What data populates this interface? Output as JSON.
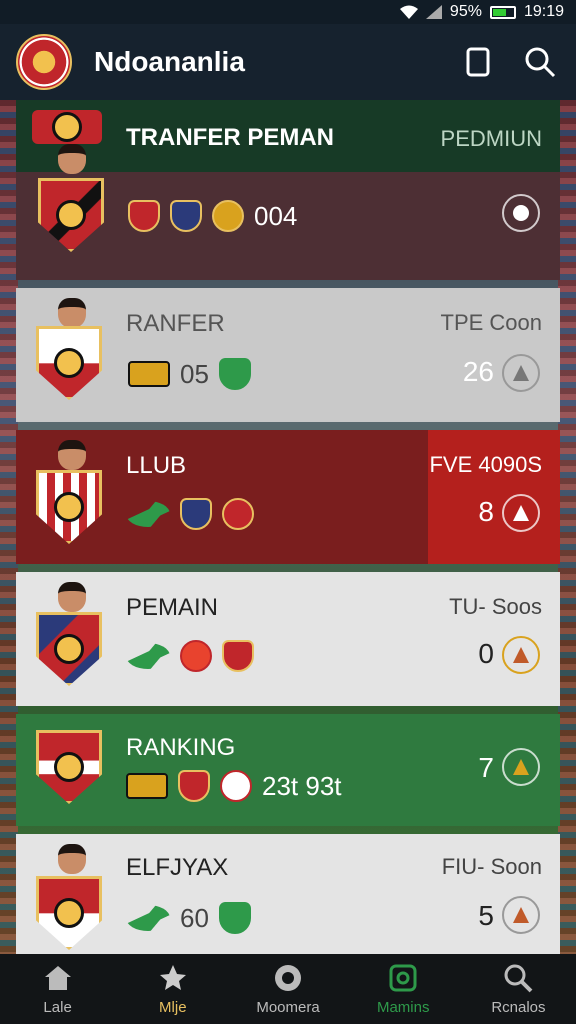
{
  "status_bar": {
    "battery": "95%",
    "time": "19:19"
  },
  "header": {
    "title": "Ndoananlia"
  },
  "cards": [
    {
      "title": "TRANFER PEMAN",
      "right_label": "PEDMIUN",
      "badge_value": "004",
      "colors": {
        "top": "#173a26",
        "bottom": "#4d2f34"
      }
    },
    {
      "title": "RANFER",
      "right_label": "TPE Coon",
      "badge_value": "05",
      "number": "26",
      "colors": {
        "bg": "#c9c9c9",
        "text": "#555555"
      }
    },
    {
      "title": "LLUB",
      "right_label": "FVE 4090S",
      "number": "8",
      "colors": {
        "bg": "#7a1e1e",
        "accent": "#b4201d"
      }
    },
    {
      "title": "PEMAIN",
      "right_label": "TU- Soos",
      "number": "0",
      "colors": {
        "bg": "#e4e4e4",
        "text": "#222222"
      }
    },
    {
      "title": "RANKING",
      "badge_value": "23t 93t",
      "number": "7",
      "colors": {
        "bg": "#2f7a3f"
      }
    },
    {
      "title": "ELFJYAX",
      "right_label": "FIU- Soon",
      "badge_value": "60",
      "number": "5",
      "colors": {
        "bg": "#e4e4e4",
        "text": "#222222"
      }
    }
  ],
  "bottom_nav": [
    {
      "label": "Lale",
      "icon": "home-icon"
    },
    {
      "label": "Mlje",
      "icon": "star-icon",
      "active": true
    },
    {
      "label": "Moomera",
      "icon": "record-icon"
    },
    {
      "label": "Mamins",
      "icon": "shield-icon"
    },
    {
      "label": "Rcnalos",
      "icon": "search-icon"
    }
  ]
}
